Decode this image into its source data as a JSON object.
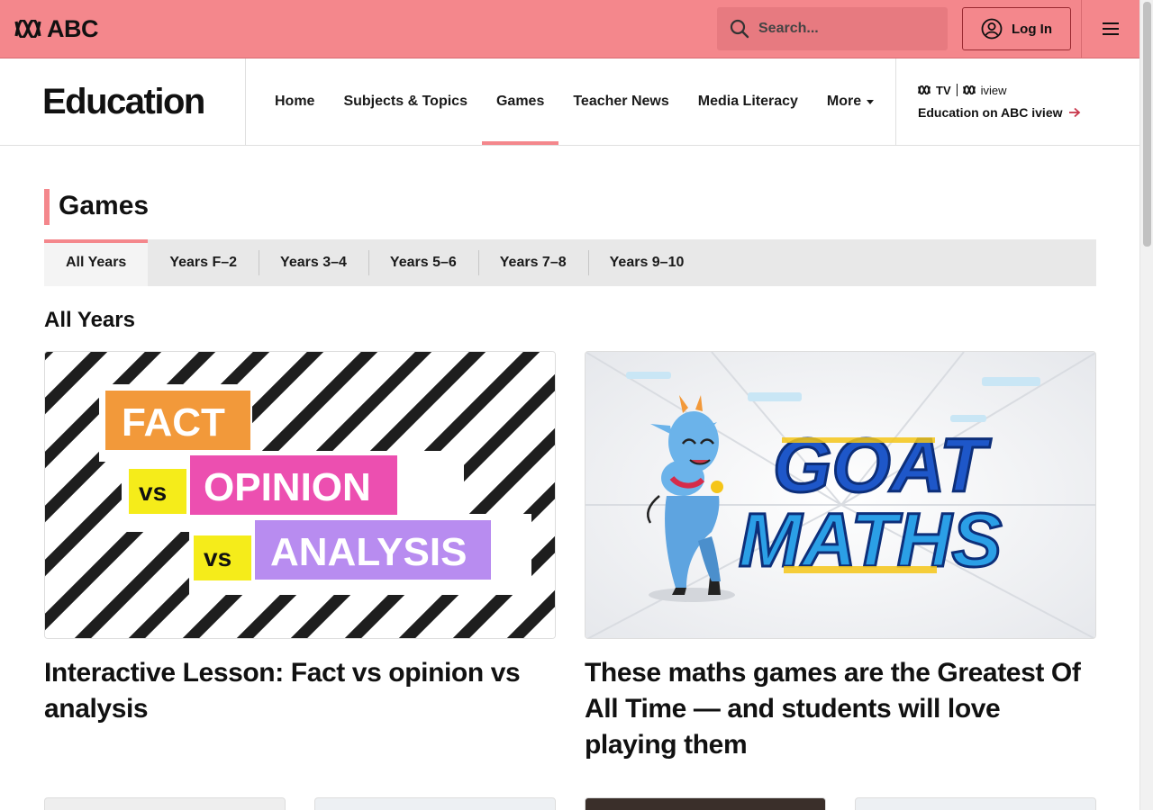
{
  "header": {
    "logo_text": "ABC",
    "search_placeholder": "Search...",
    "login_label": "Log In",
    "brand_color": "#f4878c"
  },
  "section": {
    "title": "Education",
    "nav": [
      {
        "label": "Home"
      },
      {
        "label": "Subjects & Topics"
      },
      {
        "label": "Games",
        "active": true
      },
      {
        "label": "Teacher News"
      },
      {
        "label": "Media Literacy"
      },
      {
        "label": "More"
      }
    ],
    "promo": {
      "logo_tv": "TV",
      "logo_iview": "iview",
      "link_label": "Education on ABC iview"
    }
  },
  "page": {
    "heading": "Games",
    "tabs": [
      {
        "label": "All Years",
        "active": true
      },
      {
        "label": "Years F–2"
      },
      {
        "label": "Years 3–4"
      },
      {
        "label": "Years 5–6"
      },
      {
        "label": "Years 7–8"
      },
      {
        "label": "Years 9–10"
      }
    ],
    "subheading": "All Years"
  },
  "cards": [
    {
      "title": "Interactive Lesson: Fact vs opinion vs analysis",
      "image": {
        "word1": "FACT",
        "vs1": "vs",
        "word2": "OPINION",
        "vs2": "vs",
        "word3": "ANALYSIS",
        "colors": {
          "fact": "#f2993a",
          "opinion": "#ec4fb0",
          "analysis": "#b88cf0",
          "vs": "#f5ec1a"
        }
      }
    },
    {
      "title": "These maths games are the Greatest Of All Time — and students will love playing them",
      "image": {
        "line1": "GOAT",
        "line2": "MATHS"
      }
    }
  ]
}
